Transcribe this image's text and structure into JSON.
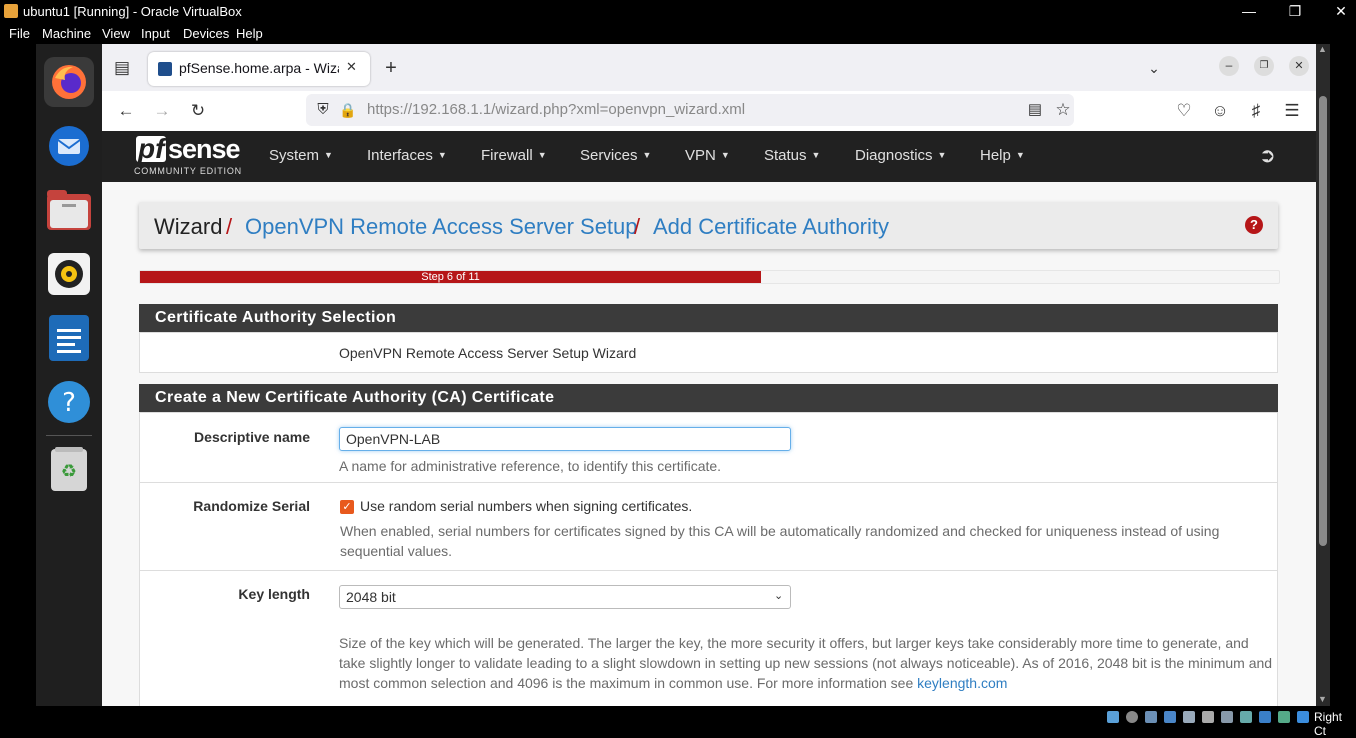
{
  "vbox": {
    "title": "ubuntu1 [Running] - Oracle VirtualBox",
    "menu": [
      "File",
      "Machine",
      "View",
      "Input",
      "Devices",
      "Help"
    ],
    "host_key_label": "Right Ct"
  },
  "browser": {
    "tab_title": "pfSense.home.arpa - Wiza",
    "url_host": "https://192.168.1.1",
    "url_path": "/wizard.php?xml=openvpn_wizard.xml"
  },
  "pfsense": {
    "logo_text": "sense",
    "logo_pf": "pf",
    "logo_sub": "COMMUNITY EDITION",
    "nav": [
      "System",
      "Interfaces",
      "Firewall",
      "Services",
      "VPN",
      "Status",
      "Diagnostics",
      "Help"
    ],
    "breadcrumb": {
      "root": "Wizard",
      "sep": "/",
      "level1": "OpenVPN Remote Access Server Setup",
      "level2": "Add Certificate Authority"
    },
    "help_icon": "question-mark",
    "progress_label": "Step 6 of 11",
    "progress_fraction": 0.545
  },
  "form": {
    "section1_title": "Certificate Authority Selection",
    "section1_text": "OpenVPN Remote Access Server Setup Wizard",
    "section2_title": "Create a New Certificate Authority (CA) Certificate",
    "descr_label": "Descriptive name",
    "descr_value": "OpenVPN-LAB",
    "descr_help": "A name for administrative reference, to identify this certificate.",
    "serial_label": "Randomize Serial",
    "serial_checkbox_label": "Use random serial numbers when signing certificates.",
    "serial_help": "When enabled, serial numbers for certificates signed by this CA will be automatically randomized and checked for uniqueness instead of using sequential values.",
    "keylen_label": "Key length",
    "keylen_value": "2048 bit",
    "keylen_help": "Size of the key which will be generated. The larger the key, the more security it offers, but larger keys take considerably more time to generate, and take slightly longer to validate leading to a slight slowdown in setting up new sessions (not always noticeable). As of 2016, 2048 bit is the minimum and most common selection and 4096 is the maximum in common use. For more information see",
    "keylen_link": "keylength.com"
  },
  "colors": {
    "accent_red": "#b61618",
    "link_blue": "#2f7ec2",
    "checkbox_orange": "#e8591d",
    "nav_dark": "#212121"
  }
}
